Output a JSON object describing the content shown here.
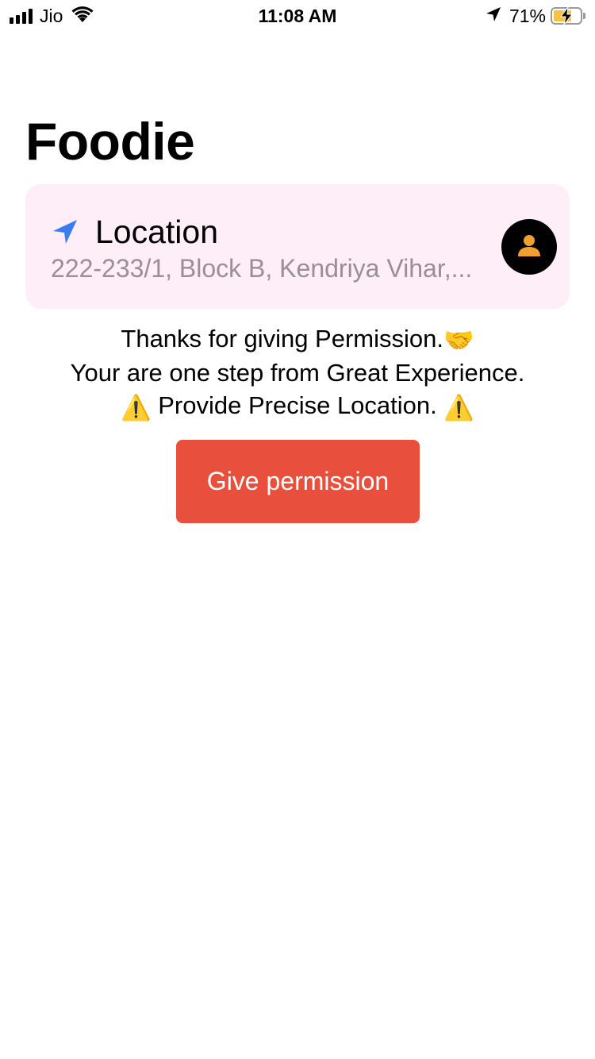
{
  "status_bar": {
    "carrier": "Jio",
    "time": "11:08 AM",
    "battery_percent": "71%",
    "battery_level": 0.71
  },
  "app": {
    "title": "Foodie"
  },
  "location_card": {
    "title": "Location",
    "address": "222-233/1, Block B, Kendriya Vihar,...",
    "icon": "navigation-arrow-icon",
    "avatar_icon": "user-icon",
    "background_color": "#fdeef8",
    "icon_color": "#3b7cf0",
    "avatar_icon_color": "#f0a033"
  },
  "message": {
    "line1": "Thanks for giving Permission.",
    "line2": "Your are one step from Great Experience.",
    "line3": "Provide Precise Location.",
    "handshake_emoji": "🤝",
    "warning_emoji": "⚠️"
  },
  "button": {
    "label": "Give permission",
    "color": "#e94f3d"
  }
}
